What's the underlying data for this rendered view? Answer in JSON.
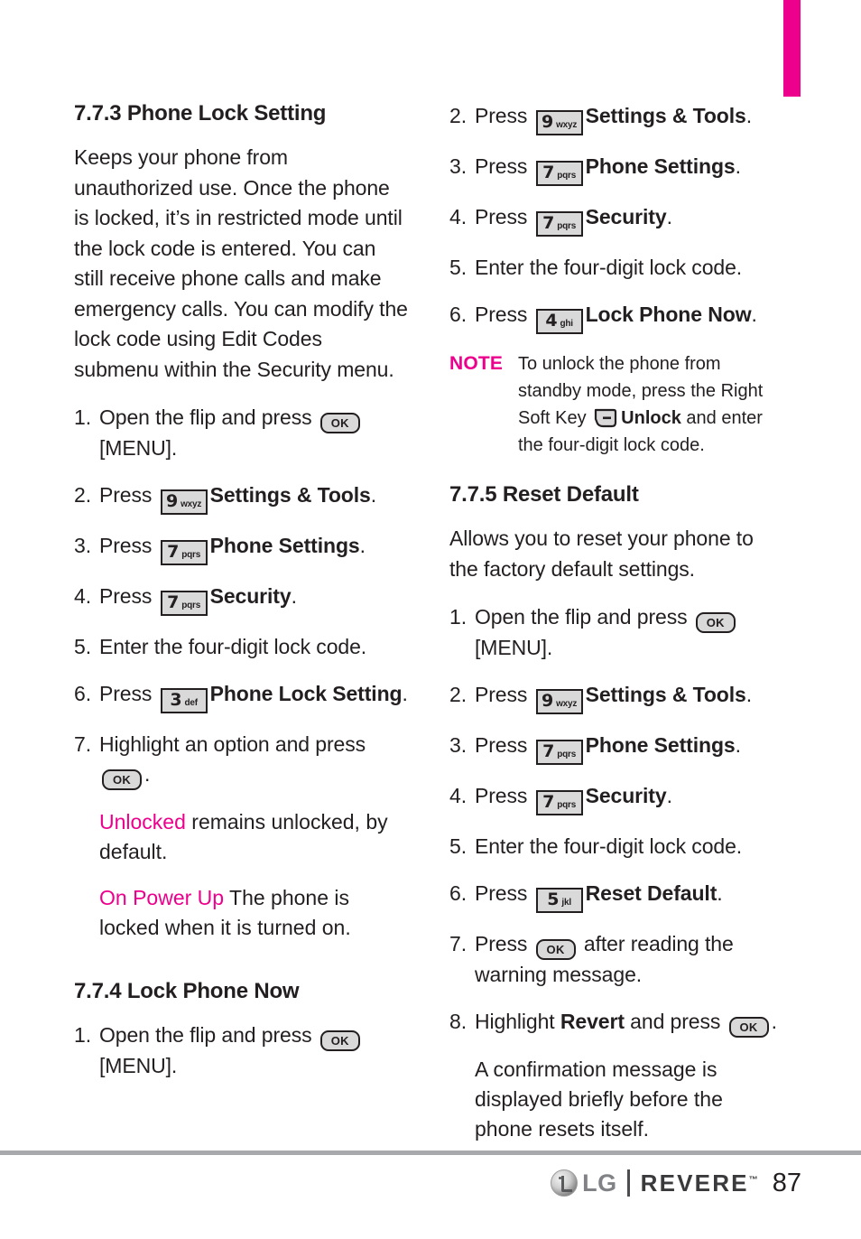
{
  "page": {
    "number": "87",
    "tab_color": "#ec008c",
    "accent_color": "#ec008c"
  },
  "footer": {
    "brand": "LG",
    "model": "REVERE",
    "trademark": "™",
    "page_number": "87"
  },
  "left_column": {
    "section_1": {
      "heading": "7.7.3 Phone Lock Setting",
      "intro": "Keeps your phone from unauthorized use. Once the phone is locked, it’s in restricted mode until the lock code is entered. You can still receive phone calls and make emergency calls. You can modify the lock code using Edit Codes submenu within the Security menu.",
      "steps": [
        {
          "num": "1.",
          "pre": "Open the flip and press ",
          "key": "ok",
          "post": " [MENU]."
        },
        {
          "num": "2.",
          "pre": "Press ",
          "key": "9",
          "key_letters": "wxyz",
          "bold": "Settings & Tools",
          "post": "."
        },
        {
          "num": "3.",
          "pre": "Press ",
          "key": "7",
          "key_letters": "pqrs",
          "bold": "Phone Settings",
          "post": "."
        },
        {
          "num": "4.",
          "pre": "Press ",
          "key": "7",
          "key_letters": "pqrs",
          "bold": "Security",
          "post": "."
        },
        {
          "num": "5.",
          "pre": "Enter the four-digit lock code.",
          "key": "",
          "post": ""
        },
        {
          "num": "6.",
          "pre": "Press ",
          "key": "3",
          "key_letters": "def",
          "bold": "Phone Lock Setting",
          "post": "."
        },
        {
          "num": "7.",
          "pre": "Highlight an option and press ",
          "key": "ok",
          "post": "."
        }
      ],
      "options": [
        {
          "term": "Unlocked",
          "desc": " remains unlocked, by default."
        },
        {
          "term": "On Power Up",
          "desc": " The phone is locked when it is turned on."
        }
      ]
    },
    "section_2": {
      "heading": "7.7.4 Lock Phone Now",
      "steps": [
        {
          "num": "1.",
          "pre": "Open the flip and press ",
          "key": "ok",
          "post": " [MENU]."
        }
      ]
    }
  },
  "right_column": {
    "section_2_continued": {
      "steps": [
        {
          "num": "2.",
          "pre": "Press ",
          "key": "9",
          "key_letters": "wxyz",
          "bold": "Settings & Tools",
          "post": "."
        },
        {
          "num": "3.",
          "pre": "Press ",
          "key": "7",
          "key_letters": "pqrs",
          "bold": "Phone Settings",
          "post": "."
        },
        {
          "num": "4.",
          "pre": "Press ",
          "key": "7",
          "key_letters": "pqrs",
          "bold": "Security",
          "post": "."
        },
        {
          "num": "5.",
          "pre": "Enter the four-digit lock code.",
          "key": "",
          "post": ""
        },
        {
          "num": "6.",
          "pre": "Press ",
          "key": "4",
          "key_letters": "ghi",
          "bold": "Lock Phone Now",
          "post": "."
        }
      ],
      "note": {
        "label": "NOTE",
        "text_part_1": "To unlock the phone from standby mode, press the Right Soft Key ",
        "text_bold": "Unlock",
        "text_part_2": " and enter the four-digit lock code."
      }
    },
    "section_3": {
      "heading": "7.7.5 Reset Default",
      "intro": "Allows you to reset your phone to the factory default settings.",
      "steps": [
        {
          "num": "1.",
          "pre": "Open the flip and press ",
          "key": "ok",
          "post": " [MENU]."
        },
        {
          "num": "2.",
          "pre": "Press ",
          "key": "9",
          "key_letters": "wxyz",
          "bold": "Settings & Tools",
          "post": "."
        },
        {
          "num": "3.",
          "pre": "Press ",
          "key": "7",
          "key_letters": "pqrs",
          "bold": "Phone Settings",
          "post": "."
        },
        {
          "num": "4.",
          "pre": "Press ",
          "key": "7",
          "key_letters": "pqrs",
          "bold": "Security",
          "post": "."
        },
        {
          "num": "5.",
          "pre": "Enter the four-digit lock code.",
          "key": "",
          "post": ""
        },
        {
          "num": "6.",
          "pre": "Press ",
          "key": "5",
          "key_letters": "jkl",
          "bold": "Reset Default",
          "post": "."
        },
        {
          "num": "7.",
          "pre": "Press ",
          "key": "ok",
          "post": " after reading the warning message."
        },
        {
          "num": "8.",
          "pre": "Highlight ",
          "bold": "Revert",
          "mid": " and press ",
          "key2": "ok",
          "post": "."
        }
      ],
      "closing": "A confirmation message is displayed briefly before the phone resets itself."
    }
  },
  "icons": {
    "ok_key": "OK",
    "soft_key": "right-soft-key"
  }
}
